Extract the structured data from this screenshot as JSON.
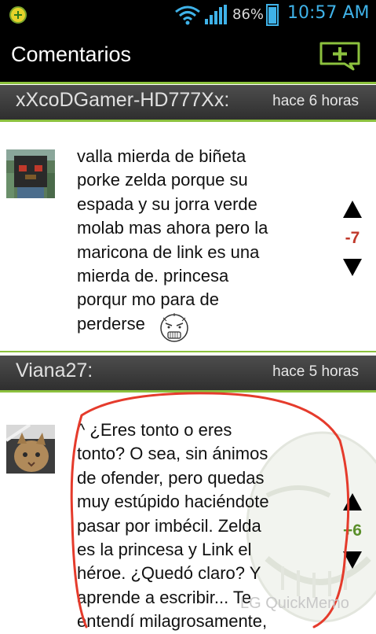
{
  "status_bar": {
    "battery_pct": "86%",
    "time": "10:57 AM",
    "battery_level": 0.86
  },
  "action_bar": {
    "title": "Comentarios",
    "add_icon": "add-comment-icon"
  },
  "comments": [
    {
      "user": "xXcoDGamer-HD777Xx:",
      "when": "hace 6 horas",
      "text": "valla mierda de biñeta\nporke zelda porque su\nespada y su jorra verde\nmolab mas ahora pero la\nmaricona de link es una\nmierda de. princesa\nporqur mo para de\nperderse",
      "score": "-7",
      "score_color": "#c0392b"
    },
    {
      "user": "Viana27:",
      "when": "hace 5 horas",
      "text": "^ ¿Eres tonto o eres\ntonto? O sea, sin ánimos\nde ofender, pero quedas\nmuy estúpido haciéndote\npasar por imbécil. Zelda\nes la princesa y Link el\nhéroe. ¿Quedó claro? Y\naprende a escribir... Te\nentendí milagrosamente,",
      "score": "+6",
      "score_color": "#5a8f2a"
    }
  ],
  "watermark": "LG QuickMemo",
  "colors": {
    "accent": "#8cc13e",
    "status_blue": "#3fb2e8",
    "annotation_red": "#e53b2c"
  }
}
